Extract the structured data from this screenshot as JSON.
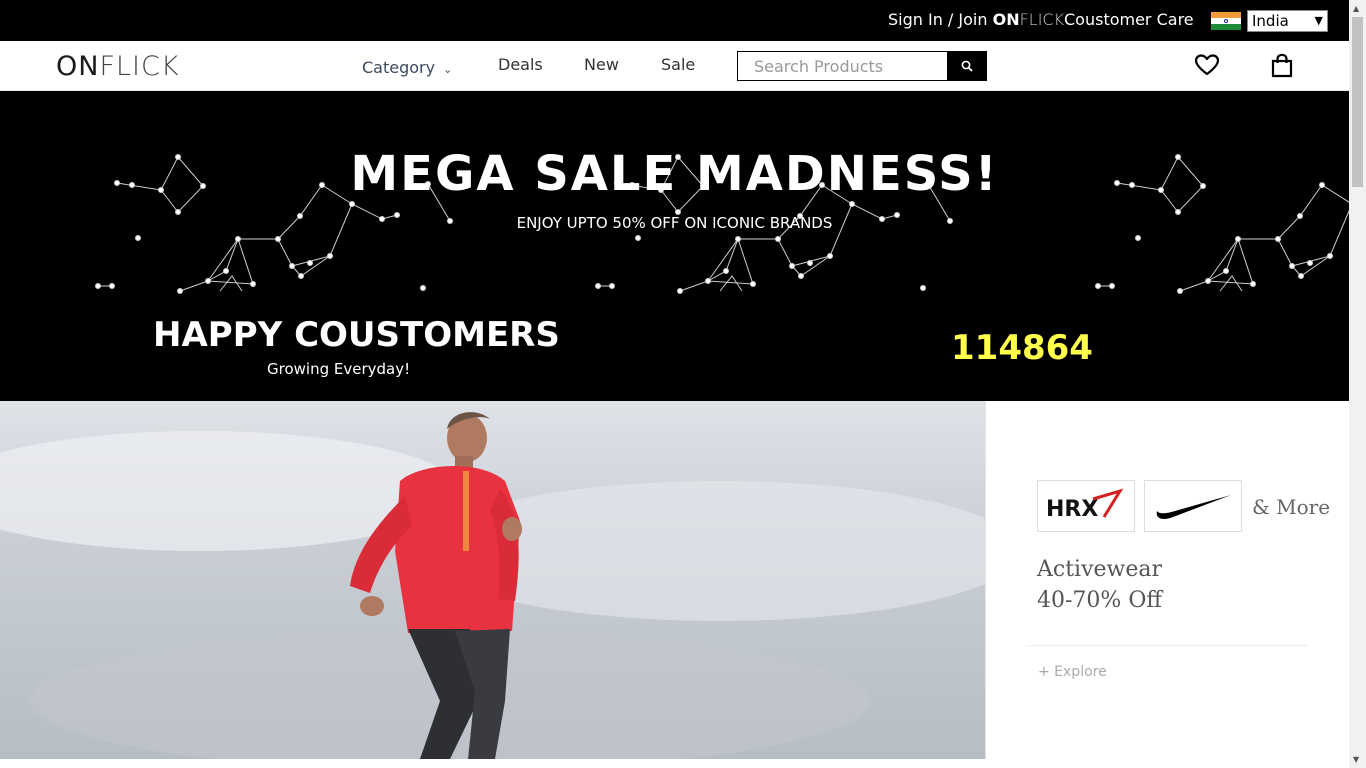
{
  "topbar": {
    "signin_prefix": "Sign In / Join ",
    "brand_on": "ON",
    "brand_flick": "FLICK",
    "customer_care": "Coustomer Care",
    "country": "India"
  },
  "nav": {
    "logo_on": "ON",
    "logo_flick": "FLICK",
    "category": "Category",
    "deals": "Deals",
    "new": "New",
    "sale": "Sale",
    "search_placeholder": "Search Products",
    "wishlist_icon": "heart-icon",
    "cart_icon": "shopping-bag-icon"
  },
  "hero": {
    "headline": "MEGA SALE MADNESS!",
    "subheadline": "ENJOY UPTO 50% OFF ON ICONIC BRANDS",
    "happy_title": "HAPPY COUSTOMERS",
    "happy_sub": "Growing Everyday!",
    "counter": "114864",
    "counter_color": "#ffff4c"
  },
  "promo": {
    "brands": [
      "HRX",
      "Nike swoosh"
    ],
    "more": "& More",
    "offer_title": "Activewear",
    "offer_discount": "40-70% Off",
    "explore": "+ Explore"
  },
  "colors": {
    "topbar_bg": "#000000",
    "hero_bg": "#000000",
    "accent_yellow": "#ffff4c"
  }
}
